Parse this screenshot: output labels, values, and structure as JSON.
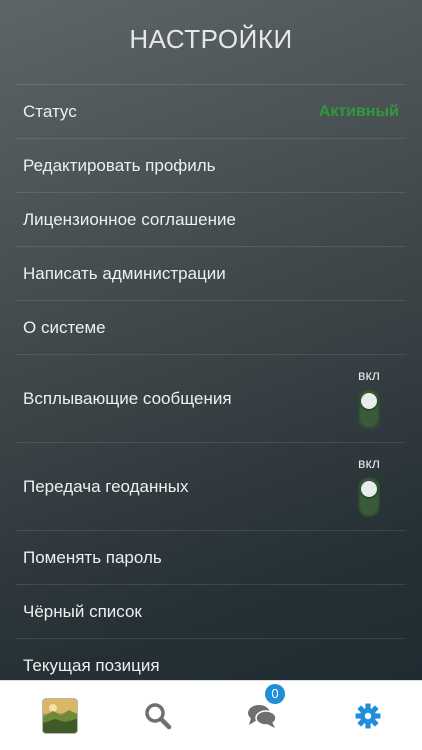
{
  "header": {
    "title": "НАСТРОЙКИ"
  },
  "settings": {
    "status_label": "Статус",
    "status_value": "Активный",
    "edit_profile": "Редактировать профиль",
    "license": "Лицензионное соглашение",
    "write_admin": "Написать администрации",
    "about": "О системе",
    "popups_label": "Всплывающие сообщения",
    "popups_state": "вкл",
    "geo_label": "Передача геоданных",
    "geo_state": "вкл",
    "change_password": "Поменять пароль",
    "blacklist": "Чёрный список",
    "current_position": "Текущая позиция"
  },
  "tabbar": {
    "profile_icon": "avatar-photo",
    "search_icon": "search-icon",
    "messages_icon": "chat-icon",
    "messages_badge": "0",
    "settings_icon": "gear-icon",
    "active_color": "#1e8fd8",
    "inactive_color": "#6f6f6f"
  }
}
